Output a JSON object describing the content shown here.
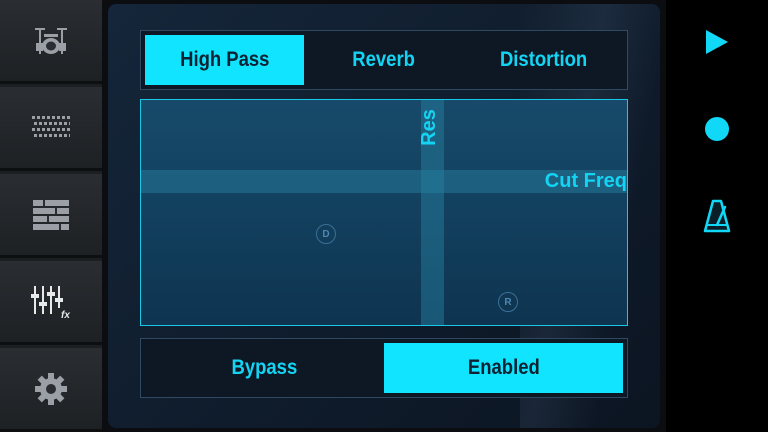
{
  "sidebar": {
    "items": [
      {
        "icon": "drum-kit-icon"
      },
      {
        "icon": "pad-grid-icon"
      },
      {
        "icon": "sequencer-icon"
      },
      {
        "icon": "mixer-fx-icon",
        "label": "fx"
      },
      {
        "icon": "gear-icon"
      }
    ]
  },
  "effects": {
    "tabs": [
      "High Pass",
      "Reverb",
      "Distortion"
    ],
    "active_tab": "High Pass"
  },
  "xy_pad": {
    "y_axis_label": "Res",
    "x_axis_label": "Cut Freq",
    "markers": [
      "D",
      "R"
    ]
  },
  "mode": {
    "bypass_label": "Bypass",
    "enabled_label": "Enabled",
    "active": "Enabled"
  },
  "transport": {
    "icons": [
      "play-icon",
      "record-icon",
      "metronome-icon"
    ]
  },
  "colors": {
    "accent": "#10e4ff",
    "panel": "#12263a",
    "sidebar": "#1c1f22"
  }
}
